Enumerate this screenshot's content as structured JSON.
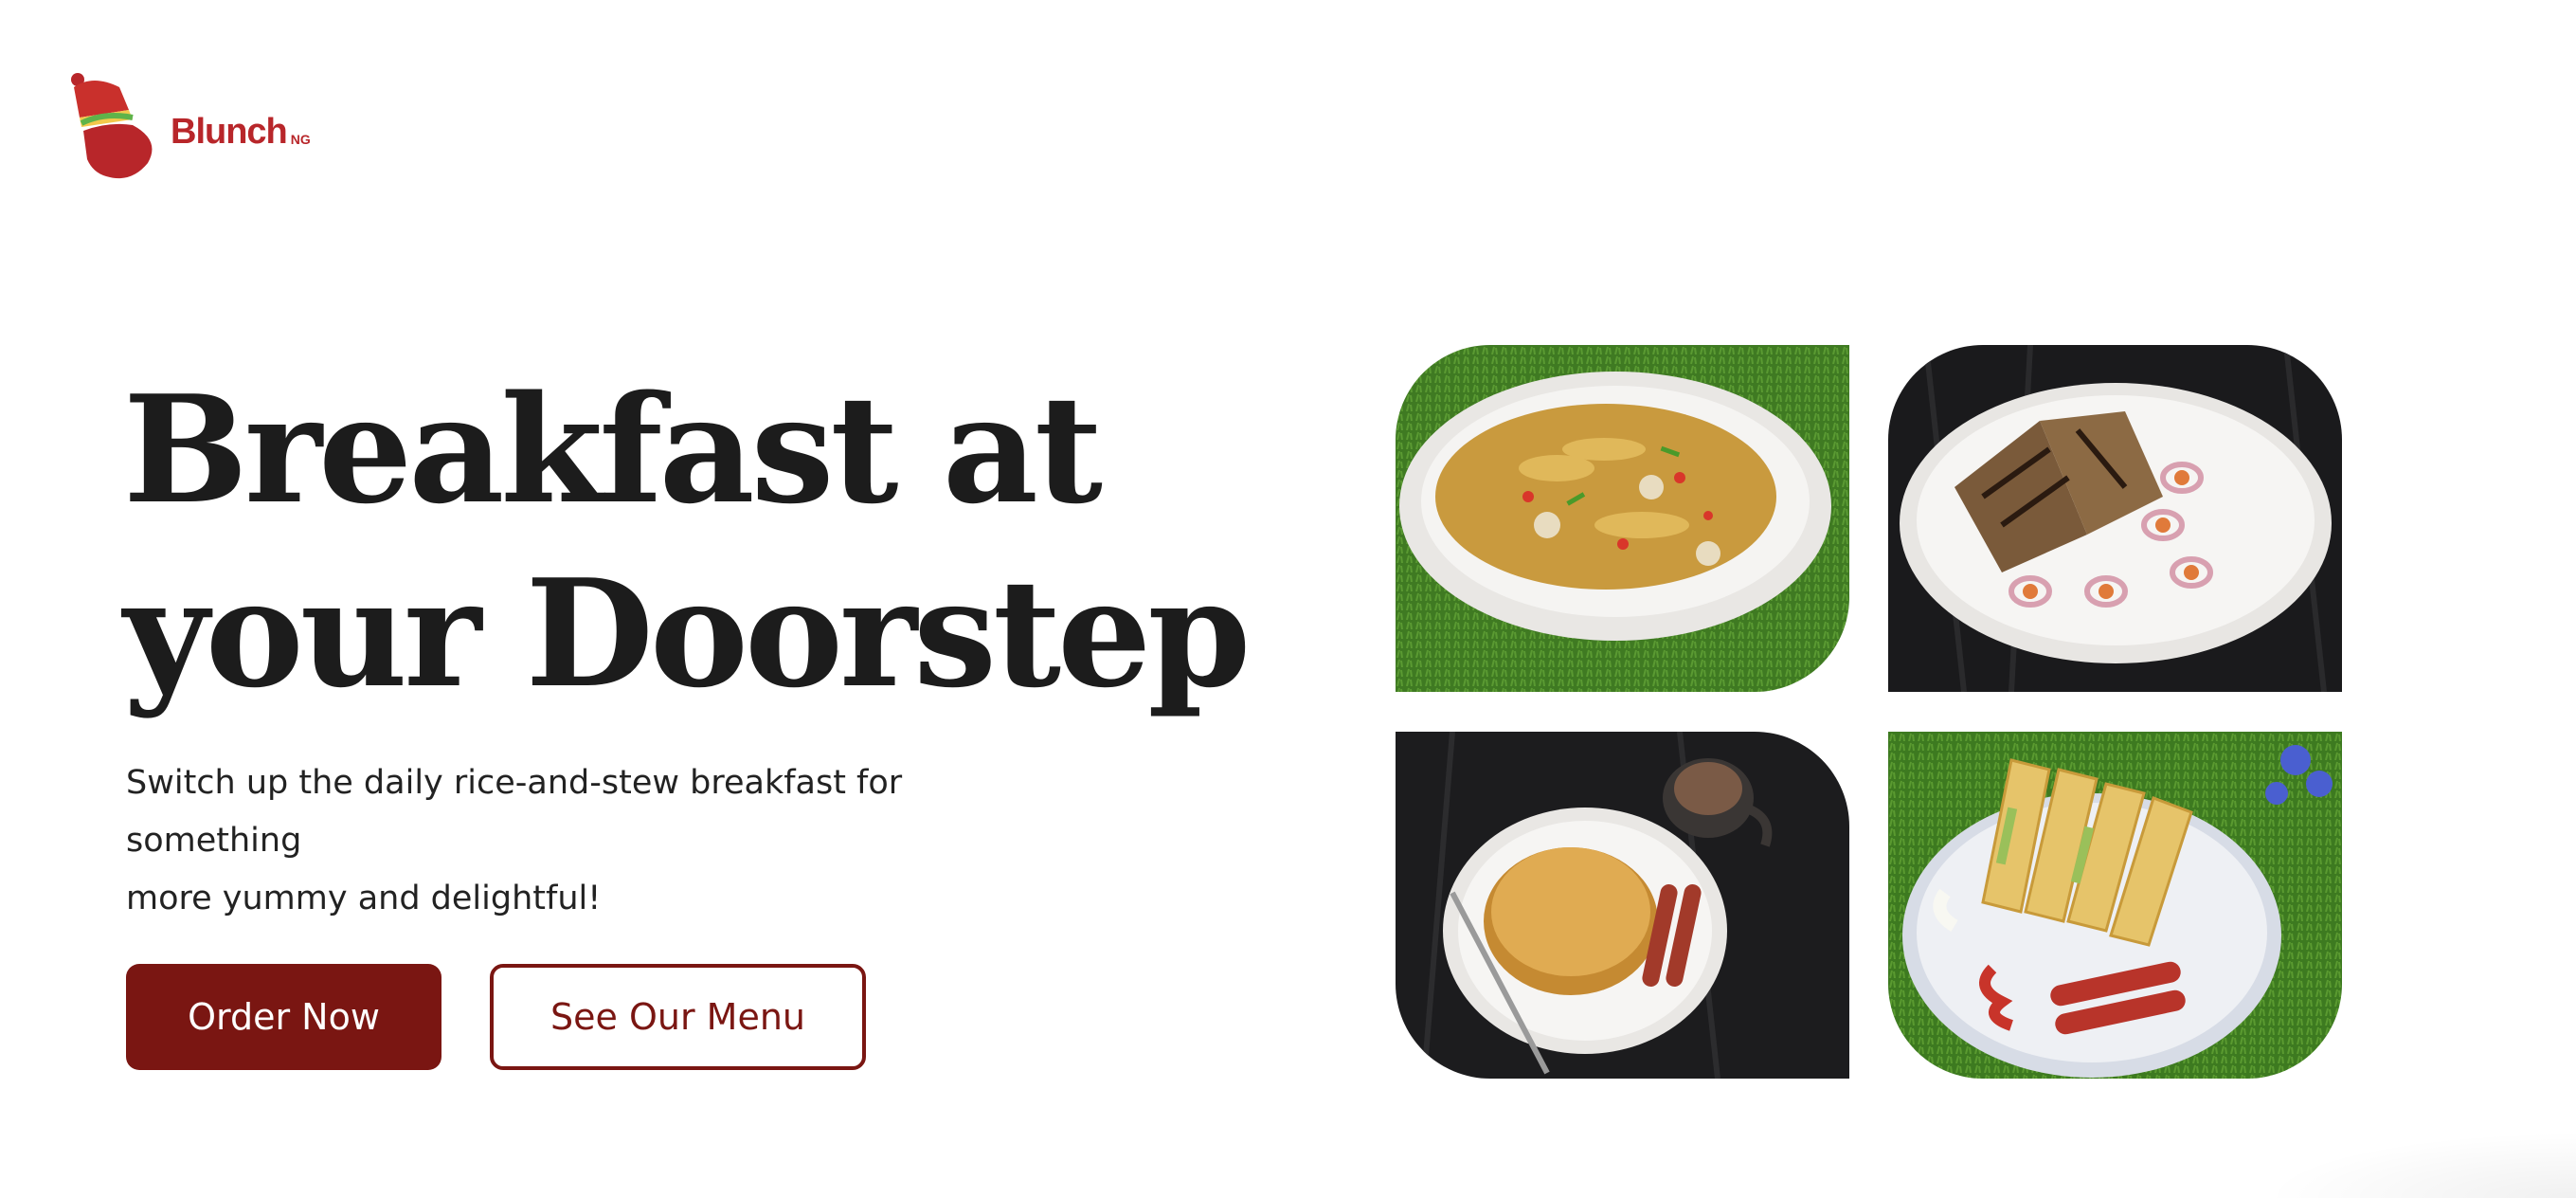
{
  "brand": {
    "name": "Blunch",
    "suffix": "NG",
    "color": "#b8262a",
    "icon": "blunch-logo-icon"
  },
  "hero": {
    "headline_line1": "Breakfast at",
    "headline_line2": "your Doorstep",
    "subtext_line1": "Switch up the daily rice-and-stew breakfast for something",
    "subtext_line2": "more yummy and delightful!"
  },
  "buttons": {
    "order_now": "Order Now",
    "see_menu": "See Our Menu",
    "accent_color": "#7a1612"
  },
  "gallery": {
    "items": [
      {
        "icon": "noodles-plate-image"
      },
      {
        "icon": "wraps-plate-image"
      },
      {
        "icon": "pancakes-plate-image"
      },
      {
        "icon": "sandwich-plate-image"
      }
    ]
  }
}
